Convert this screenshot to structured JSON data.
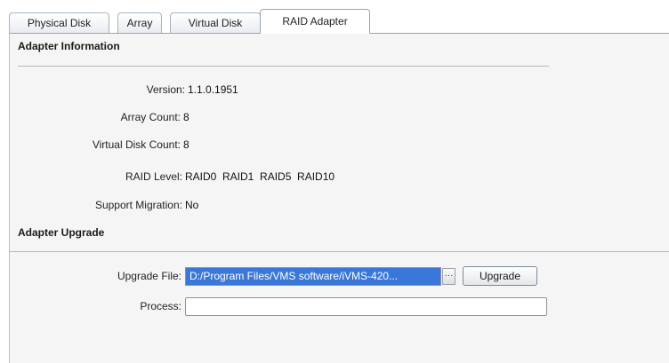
{
  "tabs": [
    {
      "label": "Physical Disk",
      "active": false
    },
    {
      "label": "Array",
      "active": false
    },
    {
      "label": "Virtual Disk",
      "active": false
    },
    {
      "label": "RAID Adapter",
      "active": true
    }
  ],
  "adapter_info": {
    "header": "Adapter Information",
    "rows": [
      {
        "label": "Version:",
        "value": "1.1.0.1951"
      },
      {
        "label": "Array Count:",
        "value": "8"
      },
      {
        "label": "Virtual Disk Count:",
        "value": "8"
      },
      {
        "label": "RAID Level:",
        "value": "RAID0  RAID1  RAID5  RAID10"
      },
      {
        "label": "Support Migration:",
        "value": "No"
      }
    ]
  },
  "adapter_upgrade": {
    "header": "Adapter Upgrade",
    "upgrade_file_label": "Upgrade File:",
    "upgrade_file_value": "D:/Program Files/VMS software/iVMS-420...",
    "browse_label": "···",
    "upgrade_button": "Upgrade",
    "process_label": "Process:",
    "process_value": ""
  },
  "colors": {
    "selection": "#3a77d8",
    "panel_bg": "#f5f5f5",
    "tab_border": "#a9b3bf"
  }
}
